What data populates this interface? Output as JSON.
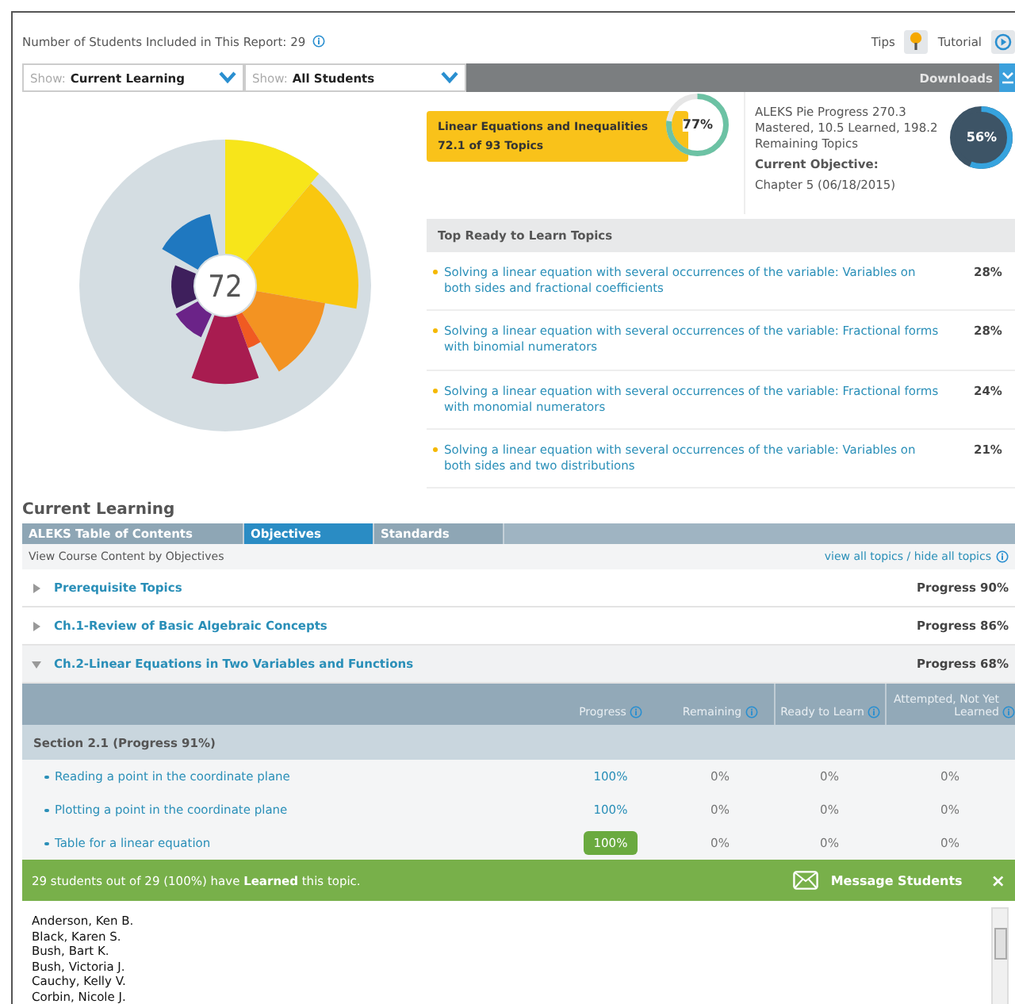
{
  "header": {
    "student_count": "Number of Students Included in This Report: 29",
    "tips": "Tips",
    "tutorial": "Tutorial"
  },
  "filters": [
    {
      "prefix": "Show:",
      "value": "Current Learning"
    },
    {
      "prefix": "Show:",
      "value": "All Students"
    }
  ],
  "downloads": "Downloads",
  "pie": {
    "center": "72"
  },
  "course": {
    "title": "Linear Equations and Inequalities",
    "topics": "72.1 of 93 Topics",
    "reading": "77%",
    "level": 0.77
  },
  "pie_progress": {
    "summary": "ALEKS Pie Progress 270.3 Mastered, 10.5 Learned, 198.2 Remaining Topics",
    "reading": "56%",
    "level": 0.56,
    "objective_label": "Current Objective:",
    "objective": "Chapter 5 (06/18/2015)"
  },
  "ready_topics": {
    "title": "Top Ready to Learn Topics",
    "items": [
      {
        "text": "Solving a linear equation with several occurrences of the variable: Variables on both sides and fractional coefficients",
        "percent": "28%"
      },
      {
        "text": "Solving a linear equation with several occurrences of the variable: Fractional forms with binomial numerators",
        "percent": "28%"
      },
      {
        "text": "Solving a linear equation with several occurrences of the variable: Fractional forms with monomial numerators",
        "percent": "24%"
      },
      {
        "text": "Solving a linear equation with several occurrences of the variable: Variables on both sides and two distributions",
        "percent": "21%"
      }
    ]
  },
  "current_learning": {
    "title": "Current Learning",
    "tabs": [
      {
        "label": "ALEKS Table of Contents",
        "selected": false
      },
      {
        "label": "Objectives",
        "selected": true
      },
      {
        "label": "Standards",
        "selected": false
      }
    ],
    "subtitle": "View Course Content by Objectives",
    "toggle_link": "view all topics / hide all topics",
    "chapters": [
      {
        "title": "Prerequisite Topics",
        "progress": "Progress 90%",
        "expanded": false
      },
      {
        "title": "Ch.1-Review of Basic Algebraic Concepts",
        "progress": "Progress 86%",
        "expanded": false
      },
      {
        "title": "Ch.2-Linear Equations in Two Variables and Functions",
        "progress": "Progress 68%",
        "expanded": true
      }
    ]
  },
  "table": {
    "columns": [
      "Progress",
      "Remaining",
      "Ready to Learn",
      "Attempted, Not Yet Learned"
    ],
    "section": "Section 2.1 (Progress 91%)",
    "rows": [
      {
        "topic": "Reading a point in the coordinate plane",
        "cells": [
          "100%",
          "0%",
          "0%",
          "0%"
        ],
        "selected": false
      },
      {
        "topic": "Plotting a point in the coordinate plane",
        "cells": [
          "100%",
          "0%",
          "0%",
          "0%"
        ],
        "selected": false
      },
      {
        "topic": "Table for a linear equation",
        "cells": [
          "100%",
          "0%",
          "0%",
          "0%"
        ],
        "selected": true
      }
    ]
  },
  "notice": {
    "text": "29 students out of 29 (100%) have **Learned** this topic.",
    "action": "Message Students",
    "close": "×"
  },
  "students": [
    "Anderson, Ken B.",
    "Black, Karen S.",
    "Bush, Bart K.",
    "Bush, Victoria J.",
    "Cauchy, Kelly V.",
    "Corbin, Nicole J."
  ]
}
